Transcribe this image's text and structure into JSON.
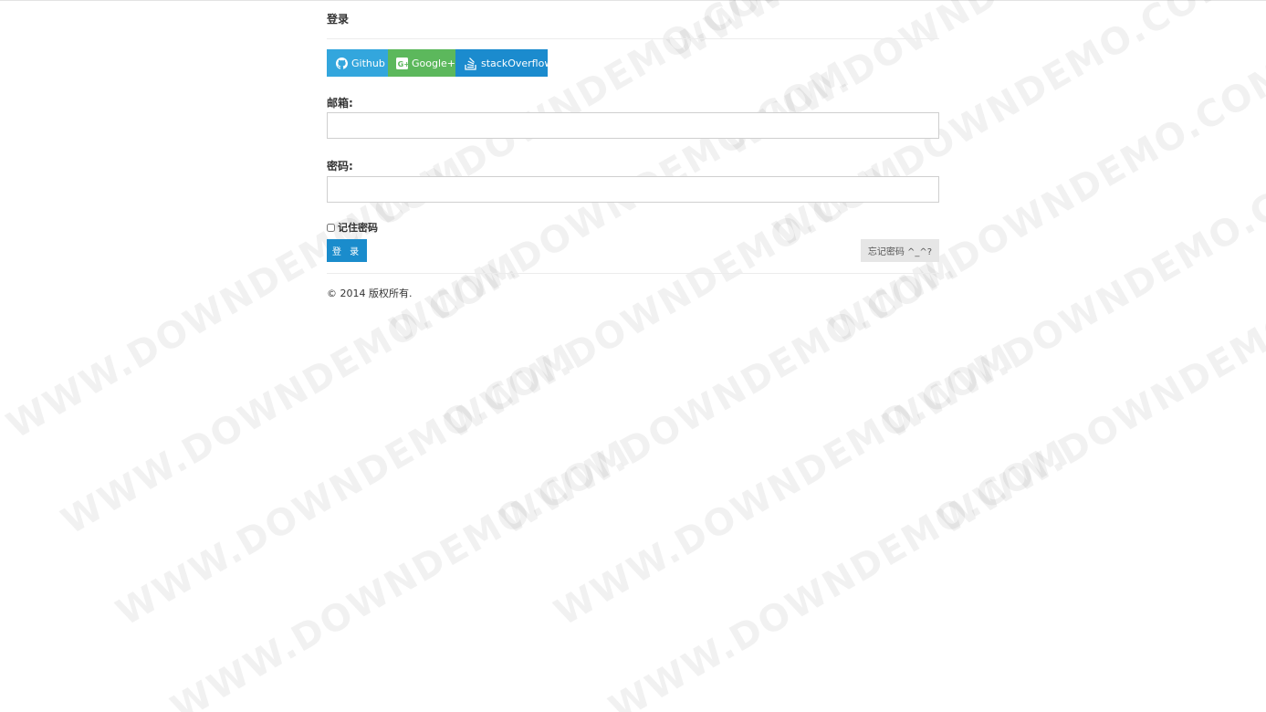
{
  "login": {
    "title": "登录",
    "social": [
      {
        "label": "Github",
        "icon": "github-icon",
        "color": "#33a6dd"
      },
      {
        "label": "Google+",
        "icon": "google-plus-icon",
        "color": "#5cb85c"
      },
      {
        "label": "stackOverflow",
        "icon": "stackoverflow-icon",
        "color": "#1b8bce"
      }
    ],
    "email_label": "邮箱:",
    "email_value": "",
    "password_label": "密码:",
    "password_value": "",
    "remember_label": "记住密码",
    "remember_checked": false,
    "submit_label": "登 录",
    "forgot_label": "忘记密码 ^_^?",
    "footer": "© 2014 版权所有."
  },
  "watermark": {
    "text": "WWW.DOWNDEMO.COM"
  },
  "colors": {
    "primary": "#1a8ccc",
    "github": "#33a6dd",
    "google": "#5cb85c",
    "stackoverflow": "#1b8bce",
    "forgot_bg": "#e6e6e6"
  }
}
